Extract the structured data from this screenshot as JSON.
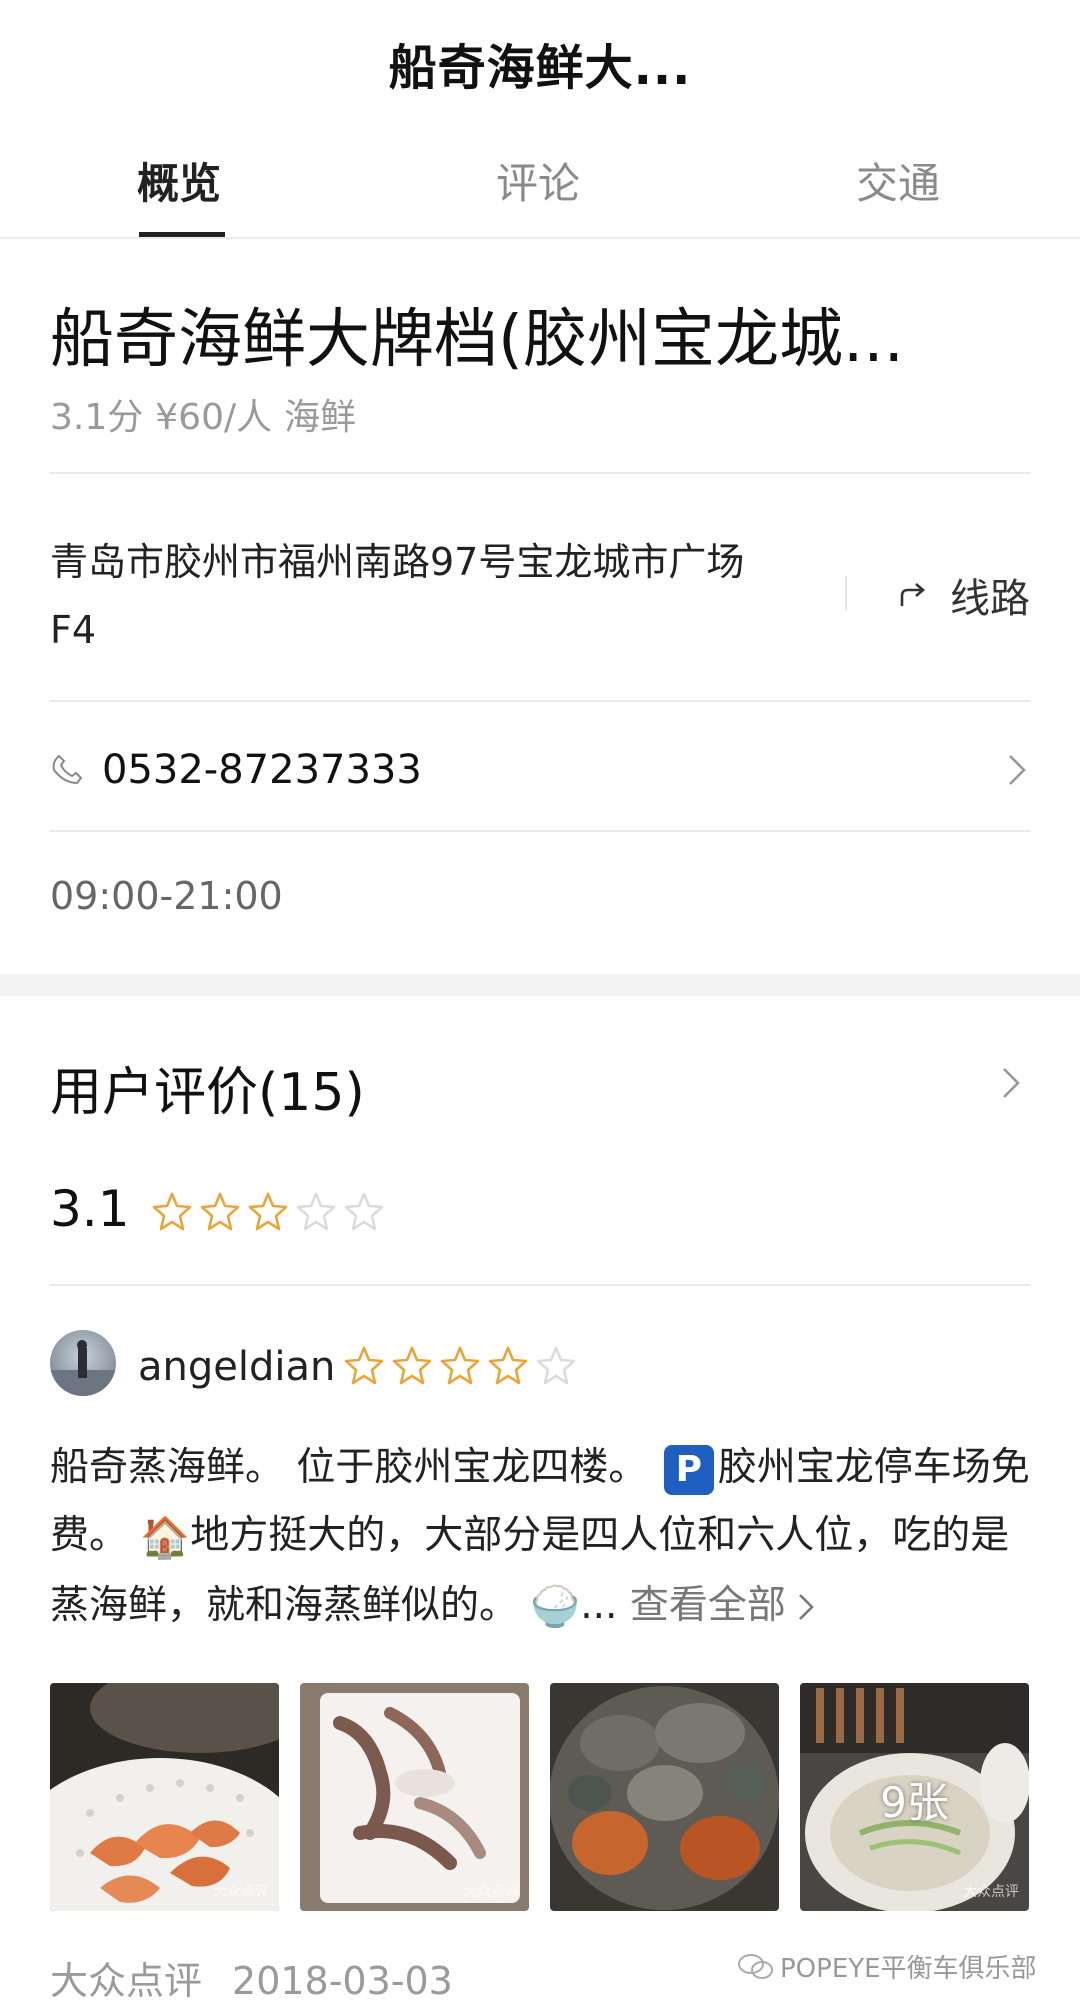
{
  "header": {
    "title": "船奇海鲜大..."
  },
  "tabs": [
    {
      "label": "概览",
      "active": true
    },
    {
      "label": "评论",
      "active": false
    },
    {
      "label": "交通",
      "active": false
    }
  ],
  "place": {
    "name": "船奇海鲜大牌档(胶州宝龙城...",
    "rating": "3.1分",
    "price": "¥60/人",
    "category": "海鲜",
    "address_line1": "青岛市胶州市福州南路97号宝龙城市广场",
    "address_line2": "F4",
    "route_label": "线路",
    "phone": "0532-87237333",
    "hours": "09:00-21:00"
  },
  "reviews": {
    "title": "用户评价(15)",
    "score": "3.1",
    "score_stars": 3,
    "item": {
      "username": "angeldian",
      "stars": 4,
      "text_1": "船奇蒸海鲜。 位于胶州宝龙四楼。 ",
      "text_2": "胶州宝龙停车场免费。 ",
      "text_3": "地方挺大的，大部分是四人位和六人位，吃的是蒸海鲜，就和海蒸鲜似的。 ",
      "text_4": "...",
      "more_label": "查看全部",
      "photo_count": "9张",
      "source": "大众点评",
      "date": "2018-03-03"
    }
  },
  "photo_watermark": "大众点评",
  "watermark": "POPEYE平衡车俱乐部",
  "colors": {
    "star": "#e8a53a",
    "star_empty": "#dcdcdc",
    "text_secondary": "#9a9a9a"
  }
}
